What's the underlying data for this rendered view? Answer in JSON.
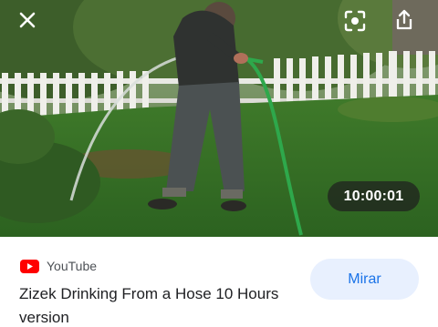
{
  "video": {
    "duration": "10:00:01",
    "controls": {
      "close_icon": "close-icon",
      "lens_icon": "lens-search-icon",
      "share_icon": "share-icon"
    }
  },
  "result": {
    "source": "YouTube",
    "source_icon": "youtube-logo-icon",
    "title": "Zizek Drinking From a Hose 10 Hours version",
    "watch_label": "Mirar"
  },
  "colors": {
    "youtube_red": "#ff0000",
    "watch_button_bg": "#e8f0fe",
    "watch_button_text": "#1a73e8",
    "title_text": "#202124",
    "source_text": "#4d5156"
  }
}
